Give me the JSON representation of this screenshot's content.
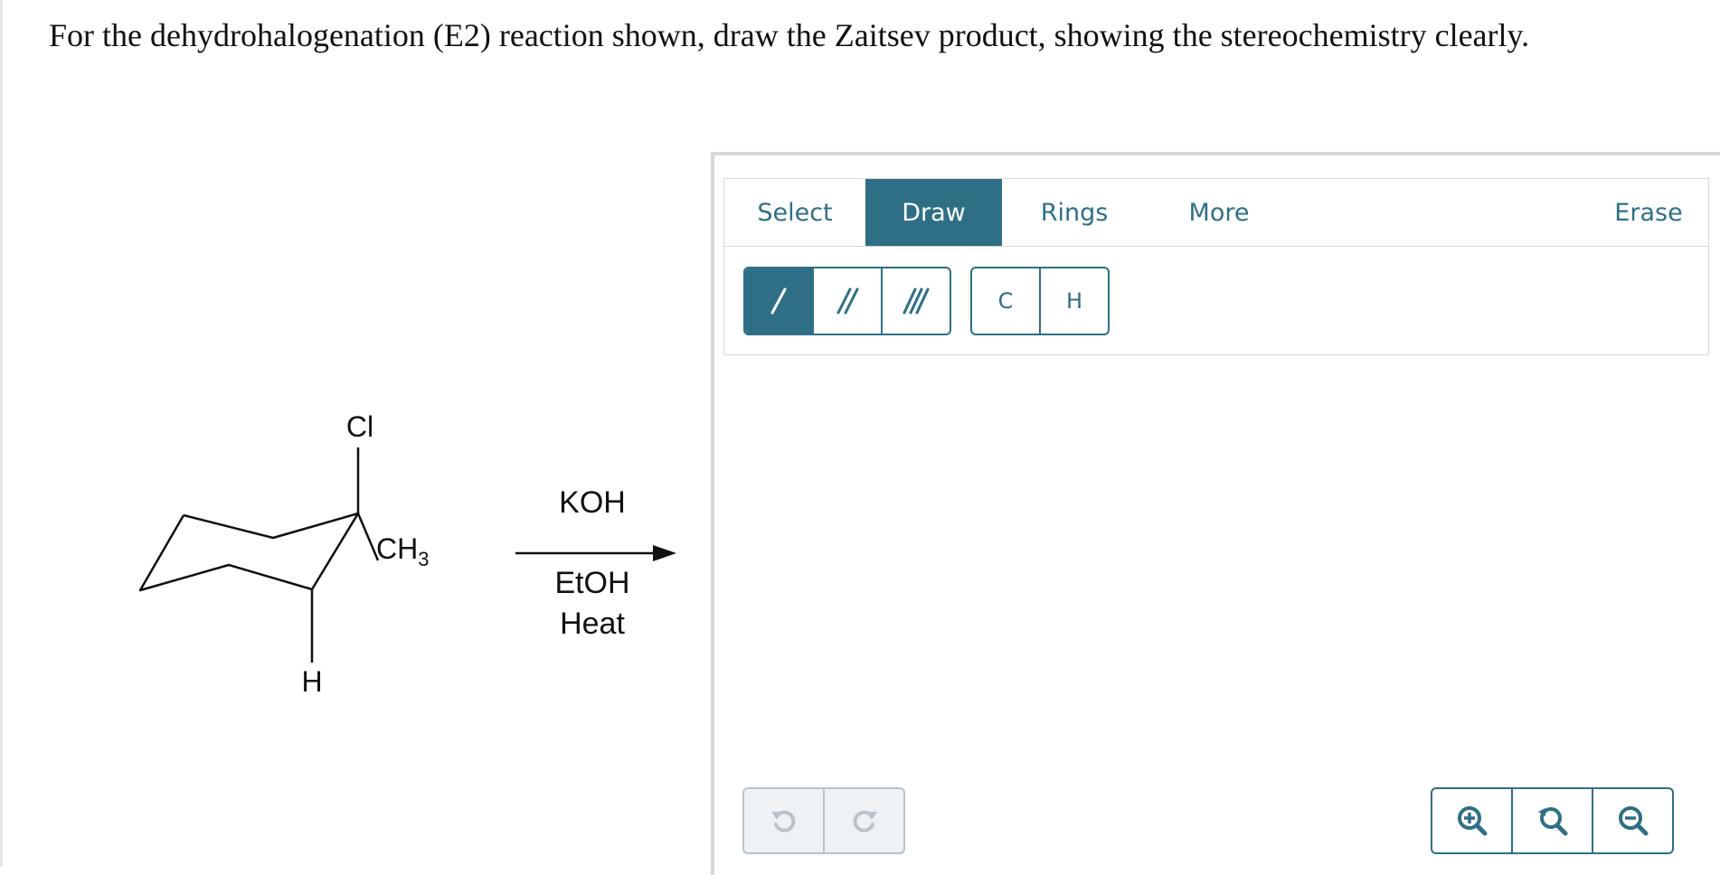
{
  "question": "For the dehydrohalogenation (E2) reaction shown, draw the Zaitsev product, showing the stereochemistry clearly.",
  "molecule": {
    "cl": "Cl",
    "h": "H",
    "ch3": "CH",
    "ch3_sub": "3"
  },
  "reagents": {
    "above": "KOH",
    "below_1": "EtOH",
    "below_2": "Heat"
  },
  "editor": {
    "tabs": {
      "select": "Select",
      "draw": "Draw",
      "rings": "Rings",
      "more": "More",
      "erase": "Erase"
    },
    "atoms": {
      "carbon": "C",
      "hydrogen": "H"
    },
    "icons": {
      "bond_single": "single-bond-icon",
      "bond_double": "double-bond-icon",
      "bond_triple": "triple-bond-icon",
      "undo": "undo-icon",
      "redo": "redo-icon",
      "zoom_in": "zoom-in-icon",
      "zoom_reset": "zoom-reset-icon",
      "zoom_out": "zoom-out-icon"
    },
    "colors": {
      "accent": "#2f6f86",
      "disabled": "#b9c3c9"
    }
  }
}
